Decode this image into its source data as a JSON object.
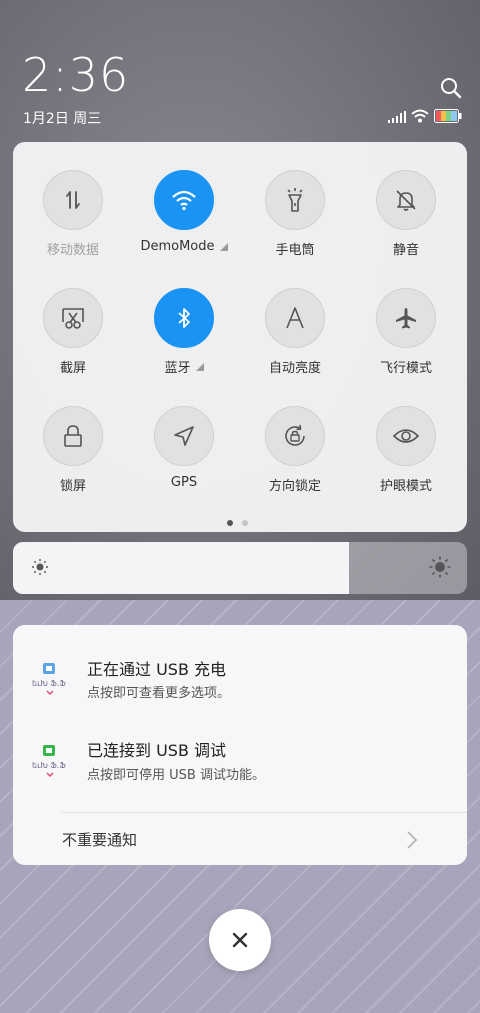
{
  "status_bar": {
    "time": "2:36",
    "date": "1月2日 周三"
  },
  "quick_settings": {
    "tiles": [
      {
        "id": "mobile-data",
        "label": "移动数据",
        "icon": "swap-arrows-icon",
        "active": false,
        "dim": true,
        "expandable": false
      },
      {
        "id": "wifi",
        "label": "DemoMode",
        "icon": "wifi-icon",
        "active": true,
        "dim": false,
        "expandable": true
      },
      {
        "id": "flashlight",
        "label": "手电筒",
        "icon": "flashlight-icon",
        "active": false,
        "dim": false,
        "expandable": false
      },
      {
        "id": "mute",
        "label": "静音",
        "icon": "bell-off-icon",
        "active": false,
        "dim": false,
        "expandable": false
      },
      {
        "id": "screenshot",
        "label": "截屏",
        "icon": "scissors-icon",
        "active": false,
        "dim": false,
        "expandable": false
      },
      {
        "id": "bluetooth",
        "label": "蓝牙",
        "icon": "bluetooth-icon",
        "active": true,
        "dim": false,
        "expandable": true
      },
      {
        "id": "auto-brightness",
        "label": "自动亮度",
        "icon": "letter-a-icon",
        "active": false,
        "dim": false,
        "expandable": false
      },
      {
        "id": "airplane",
        "label": "飞行模式",
        "icon": "airplane-icon",
        "active": false,
        "dim": false,
        "expandable": false
      },
      {
        "id": "lock-screen",
        "label": "锁屏",
        "icon": "lock-icon",
        "active": false,
        "dim": false,
        "expandable": false
      },
      {
        "id": "gps",
        "label": "GPS",
        "icon": "navigation-arrow-icon",
        "active": false,
        "dim": false,
        "expandable": false
      },
      {
        "id": "rotation-lock",
        "label": "方向锁定",
        "icon": "rotation-lock-icon",
        "active": false,
        "dim": false,
        "expandable": false
      },
      {
        "id": "eye-care",
        "label": "护眼模式",
        "icon": "eye-icon",
        "active": false,
        "dim": false,
        "expandable": false
      }
    ],
    "page_index": 1,
    "page_count": 2
  },
  "brightness": {
    "level": 0.74
  },
  "notifications": [
    {
      "title": "正在通过 USB 充电",
      "subtitle": "点按即可查看更多选项。"
    },
    {
      "title": "已连接到 USB 调试",
      "subtitle": "点按即可停用 USB 调试功能。"
    }
  ],
  "minor_notifications_label": "不重要通知",
  "colors": {
    "accent": "#1a93f4",
    "panel": "#f4f4f6"
  }
}
